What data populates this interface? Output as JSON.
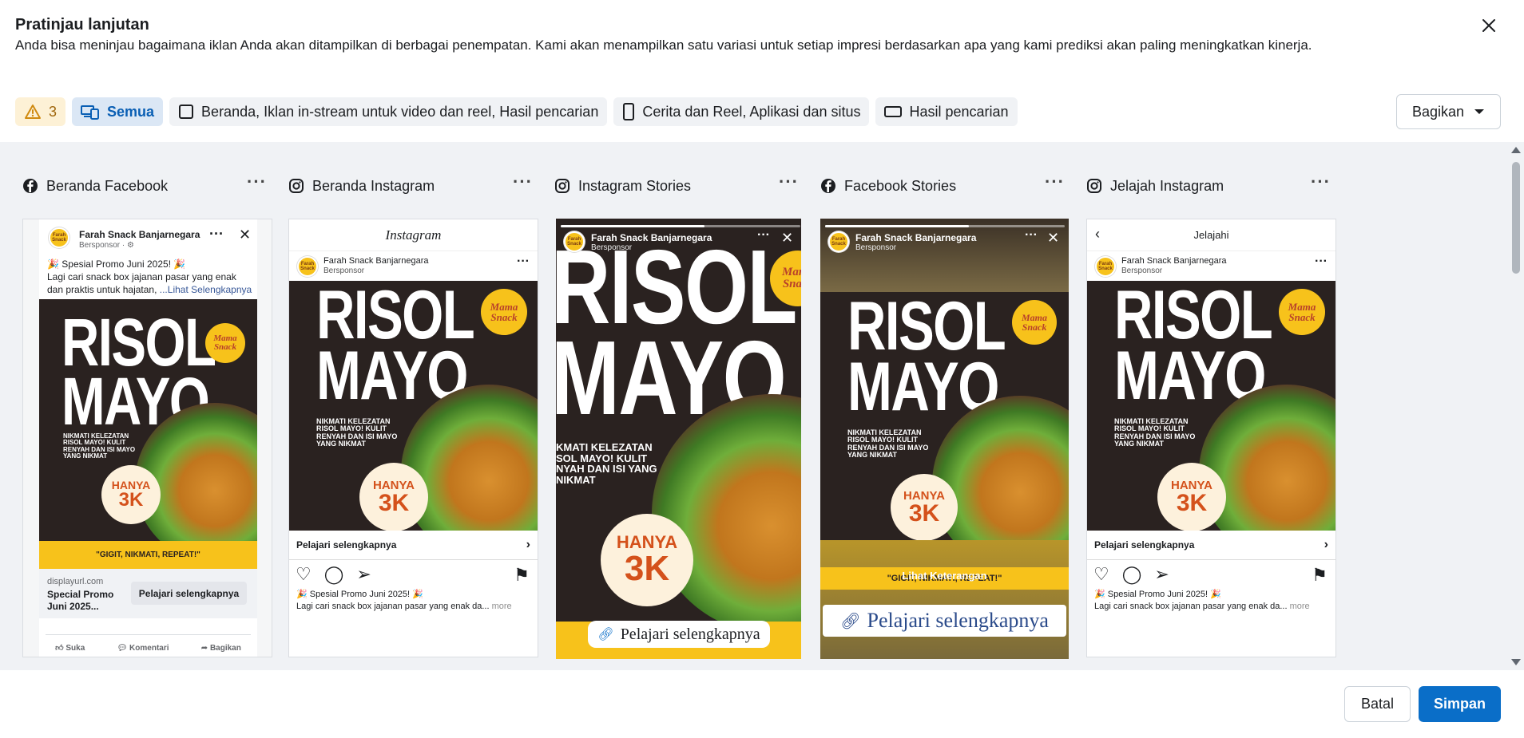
{
  "dialog": {
    "title": "Pratinjau lanjutan",
    "subtitle": "Anda bisa meninjau bagaimana iklan Anda akan ditampilkan di berbagai penempatan. Kami akan menampilkan satu variasi untuk setiap impresi berdasarkan apa yang kami prediksi akan paling meningkatkan kinerja.",
    "close_icon": "close-icon"
  },
  "filters": {
    "warning_count": "3",
    "all_label": "Semua",
    "feeds_label": "Beranda, Iklan in-stream untuk video dan reel, Hasil pencarian",
    "stories_label": "Cerita dan Reel, Aplikasi dan situs",
    "search_label": "Hasil pencarian",
    "share_label": "Bagikan"
  },
  "columns": [
    {
      "label": "Beranda Facebook",
      "icon": "facebook-icon"
    },
    {
      "label": "Beranda Instagram",
      "icon": "instagram-icon"
    },
    {
      "label": "Instagram Stories",
      "icon": "instagram-icon"
    },
    {
      "label": "Facebook Stories",
      "icon": "facebook-icon"
    },
    {
      "label": "Jelajah Instagram",
      "icon": "instagram-icon"
    }
  ],
  "ad": {
    "page_name": "Farah Snack Banjarnegara",
    "sponsored": "Bersponsor",
    "sponsored_fb": "Bersponsor · ",
    "headline_line1": "🎉 Spesial Promo Juni 2025! 🎉",
    "body": "Lagi cari snack box jajanan pasar yang enak dan praktis untuk hajatan, ",
    "see_more": "...Lihat Selengkapnya",
    "caption_ig": "🎉 Spesial Promo Juni 2025! 🎉",
    "caption_ig_body": "Lagi cari snack box jajanan pasar yang enak da...",
    "ig_more": "more",
    "creative_title1": "RISOL",
    "creative_title2": "MAYO",
    "creative_tagline": "NIKMATI KELEZATAN RISOL MAYO! KULIT RENYAH DAN ISI MAYO YANG NIKMAT",
    "creative_tagline_ig": "NIKMATI KELEZATAN RISOL MAYO!  KULIT RENYAH DAN ISI MAYO YANG NIKMAT",
    "creative_tagline_story": "KMATI KELEZATAN SOL MAYO!  KULIT NYAH DAN ISI YANG NIKMAT",
    "badge_top": "HANYA",
    "badge_bottom": "3K",
    "slogan": "\"GIGIT, NIKMATI, REPEAT!\"",
    "logo_line1": "Mama",
    "logo_line2": "Snack",
    "avatar_text": "Farah Snack",
    "display_url": "displayurl.com",
    "link_title": "Special Promo Juni 2025...",
    "cta": "Pelajari selengkapnya",
    "learn_more_ig": "Pelajari selengkapnya",
    "fb_like": "Suka",
    "fb_comment": "Komentari",
    "fb_share": "Bagikan",
    "instagram_logo": "Instagram",
    "explore_title": "Jelajahi",
    "fb_story_overlay": "Lihat Keterangan"
  },
  "footer": {
    "cancel": "Batal",
    "save": "Simpan"
  },
  "colors": {
    "primary": "#0a6ec8",
    "warning_bg": "#fdf1d6",
    "active_bg": "#dbe7f5",
    "creative_bg": "#2a2220",
    "accent_yellow": "#f7c21b"
  }
}
